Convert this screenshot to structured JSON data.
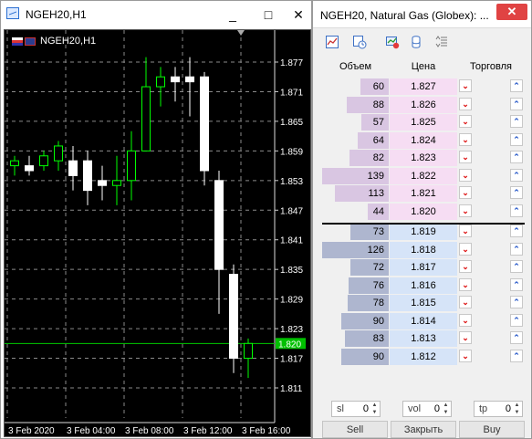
{
  "chart_window": {
    "title": "NGEH20,H1",
    "minimize": "_",
    "maximize": "□",
    "close": "✕",
    "symbol_label": "NGEH20,H1",
    "current_price": "1.820"
  },
  "chart_data": {
    "type": "candlestick",
    "price_ticks": [
      "1.877",
      "1.871",
      "1.865",
      "1.859",
      "1.853",
      "1.847",
      "1.841",
      "1.835",
      "1.829",
      "1.823",
      "1.817",
      "1.811"
    ],
    "time_labels": [
      "3 Feb 2020",
      "3 Feb 04:00",
      "3 Feb 08:00",
      "3 Feb 12:00",
      "3 Feb 16:00"
    ],
    "ylim": [
      1.808,
      1.88
    ],
    "grid": true,
    "last_price": 1.82,
    "candles": [
      {
        "o": 1.856,
        "h": 1.858,
        "l": 1.854,
        "c": 1.857
      },
      {
        "o": 1.856,
        "h": 1.858,
        "l": 1.854,
        "c": 1.855
      },
      {
        "o": 1.856,
        "h": 1.859,
        "l": 1.855,
        "c": 1.858
      },
      {
        "o": 1.857,
        "h": 1.861,
        "l": 1.855,
        "c": 1.86
      },
      {
        "o": 1.857,
        "h": 1.86,
        "l": 1.851,
        "c": 1.854
      },
      {
        "o": 1.857,
        "h": 1.859,
        "l": 1.848,
        "c": 1.851
      },
      {
        "o": 1.853,
        "h": 1.856,
        "l": 1.849,
        "c": 1.852
      },
      {
        "o": 1.852,
        "h": 1.858,
        "l": 1.848,
        "c": 1.853
      },
      {
        "o": 1.853,
        "h": 1.863,
        "l": 1.849,
        "c": 1.859
      },
      {
        "o": 1.859,
        "h": 1.878,
        "l": 1.859,
        "c": 1.872
      },
      {
        "o": 1.872,
        "h": 1.876,
        "l": 1.868,
        "c": 1.874
      },
      {
        "o": 1.874,
        "h": 1.876,
        "l": 1.869,
        "c": 1.873
      },
      {
        "o": 1.874,
        "h": 1.878,
        "l": 1.866,
        "c": 1.873
      },
      {
        "o": 1.874,
        "h": 1.875,
        "l": 1.852,
        "c": 1.855
      },
      {
        "o": 1.853,
        "h": 1.855,
        "l": 1.826,
        "c": 1.835
      },
      {
        "o": 1.834,
        "h": 1.836,
        "l": 1.814,
        "c": 1.817
      },
      {
        "o": 1.817,
        "h": 1.821,
        "l": 1.813,
        "c": 1.82
      }
    ]
  },
  "dom_window": {
    "title": "NGEH20, Natural Gas (Globex): ...",
    "close": "✕",
    "toolbar": [
      {
        "icon": "chart-icon"
      },
      {
        "icon": "clock-chart-icon"
      },
      {
        "icon": "trade-icon"
      },
      {
        "icon": "cylinder-icon"
      },
      {
        "icon": "list-sort-icon"
      }
    ],
    "headers": {
      "volume": "Объем",
      "price": "Цена",
      "trade": "Торговля"
    },
    "asks": [
      {
        "volume": "60",
        "price": "1.827",
        "fill": 0.43
      },
      {
        "volume": "88",
        "price": "1.826",
        "fill": 0.63
      },
      {
        "volume": "57",
        "price": "1.825",
        "fill": 0.41
      },
      {
        "volume": "64",
        "price": "1.824",
        "fill": 0.46
      },
      {
        "volume": "82",
        "price": "1.823",
        "fill": 0.59
      },
      {
        "volume": "139",
        "price": "1.822",
        "fill": 1.0
      },
      {
        "volume": "113",
        "price": "1.821",
        "fill": 0.81
      },
      {
        "volume": "44",
        "price": "1.820",
        "fill": 0.32
      }
    ],
    "bids": [
      {
        "volume": "73",
        "price": "1.819",
        "fill": 0.58
      },
      {
        "volume": "126",
        "price": "1.818",
        "fill": 1.0
      },
      {
        "volume": "72",
        "price": "1.817",
        "fill": 0.57
      },
      {
        "volume": "76",
        "price": "1.816",
        "fill": 0.6
      },
      {
        "volume": "78",
        "price": "1.815",
        "fill": 0.62
      },
      {
        "volume": "90",
        "price": "1.814",
        "fill": 0.71
      },
      {
        "volume": "83",
        "price": "1.813",
        "fill": 0.66
      },
      {
        "volume": "90",
        "price": "1.812",
        "fill": 0.71
      }
    ],
    "controls": {
      "sl_label": "sl",
      "sl_value": "0",
      "vol_label": "vol",
      "vol_value": "0",
      "tp_label": "tp",
      "tp_value": "0"
    },
    "buttons": {
      "sell": "Sell",
      "close": "Закрыть",
      "buy": "Buy"
    }
  },
  "colors": {
    "ask_bar": "#d9c6e2",
    "ask_price_bg": "#f6ddf3",
    "bid_bar": "#aeb6cf",
    "bid_price_bg": "#d6e4f8",
    "bullish_wick": "#00ff00",
    "price_line": "#00cc00"
  }
}
